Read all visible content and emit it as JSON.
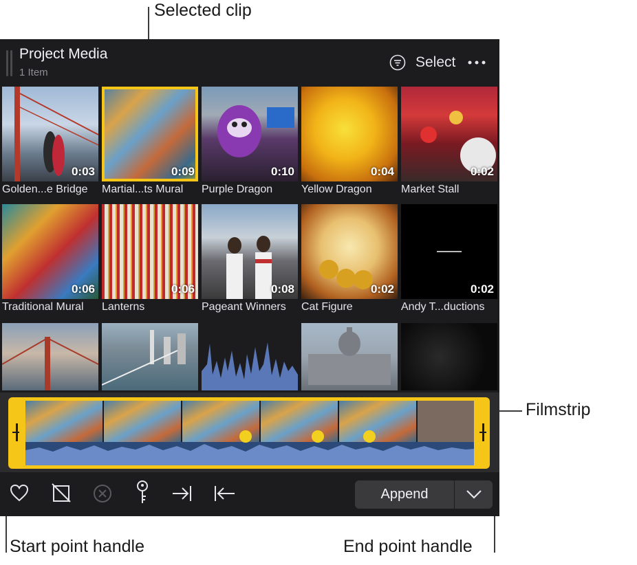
{
  "callouts": {
    "selected_clip": "Selected clip",
    "filmstrip": "Filmstrip",
    "start_handle": "Start point handle",
    "end_handle": "End point handle"
  },
  "header": {
    "title": "Project Media",
    "subtitle": "1 Item",
    "select_label": "Select"
  },
  "clips": [
    {
      "name": "Golden...e Bridge",
      "duration": "0:03"
    },
    {
      "name": "Martial...ts Mural",
      "duration": "0:09",
      "selected": true
    },
    {
      "name": "Purple Dragon",
      "duration": "0:10"
    },
    {
      "name": "Yellow Dragon",
      "duration": "0:04"
    },
    {
      "name": "Market Stall",
      "duration": "0:02"
    },
    {
      "name": "Traditional Mural",
      "duration": "0:06"
    },
    {
      "name": "Lanterns",
      "duration": "0:06"
    },
    {
      "name": "Pageant Winners",
      "duration": "0:08"
    },
    {
      "name": "Cat Figure",
      "duration": "0:02"
    },
    {
      "name": "Andy T...ductions",
      "duration": "0:02"
    }
  ],
  "toolbar": {
    "append_label": "Append",
    "icons": [
      "favorite-icon",
      "reject-icon",
      "clear-icon",
      "keyword-icon",
      "insert-right-icon",
      "insert-left-icon",
      "chevron-down-icon"
    ]
  },
  "colors": {
    "accent": "#f5c518",
    "panel_bg": "#1c1c1e"
  }
}
